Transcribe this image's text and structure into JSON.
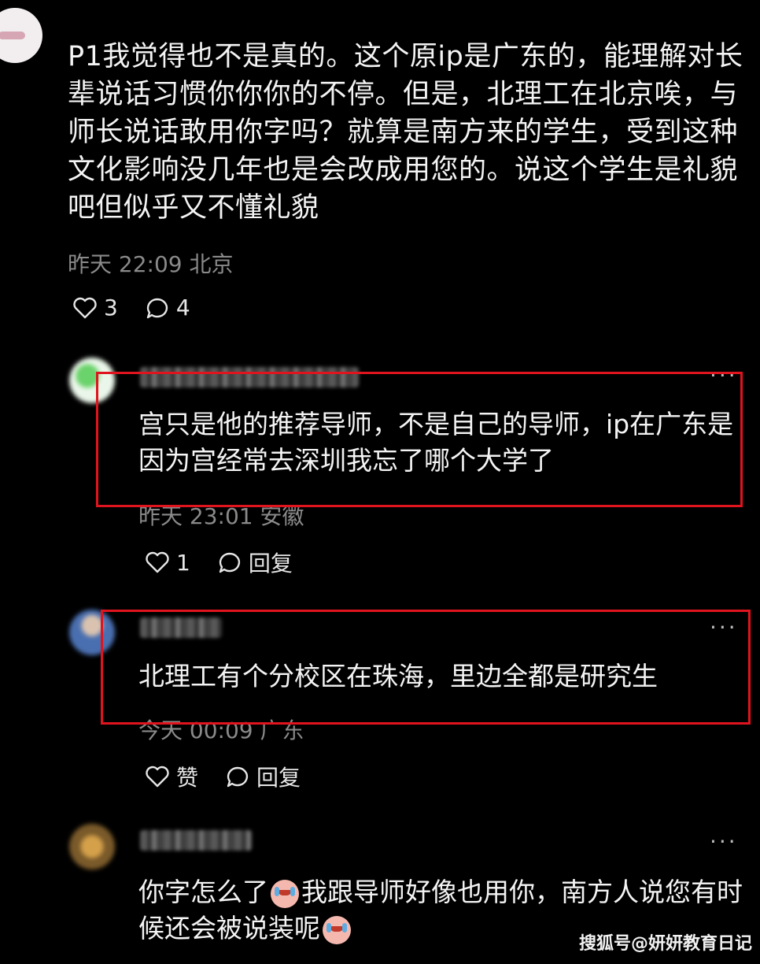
{
  "main_comment": {
    "text": "P1我觉得也不是真的。这个原ip是广东的，能理解对长辈说话习惯你你你的不停。但是，北理工在北京唉，与师长说话敢用你字吗？就算是南方来的学生，受到这种文化影响没几年也是会改成用您的。说这个学生是礼貌吧但似乎又不懂礼貌",
    "meta": "昨天 22:09 北京",
    "likes": "3",
    "replies": "4"
  },
  "replies": [
    {
      "text": "宫只是他的推荐导师，不是自己的导师，ip在广东是因为宫经常去深圳我忘了哪个大学了",
      "meta": "昨天 23:01 安徽",
      "likes": "1",
      "reply_label": "回复"
    },
    {
      "text": "北理工有个分校区在珠海，里边全都是研究生",
      "meta": "今天 00:09 广东",
      "like_label": "赞",
      "reply_label": "回复"
    },
    {
      "text_part1": "你字怎么了",
      "text_part2": "我跟导师好像也用你，南方人说您有时候还会被说装呢"
    }
  ],
  "more_label": "···",
  "watermark": "搜狐号@妍妍教育日记",
  "colors": {
    "highlight_border": "#e0141e",
    "background": "#000000"
  }
}
